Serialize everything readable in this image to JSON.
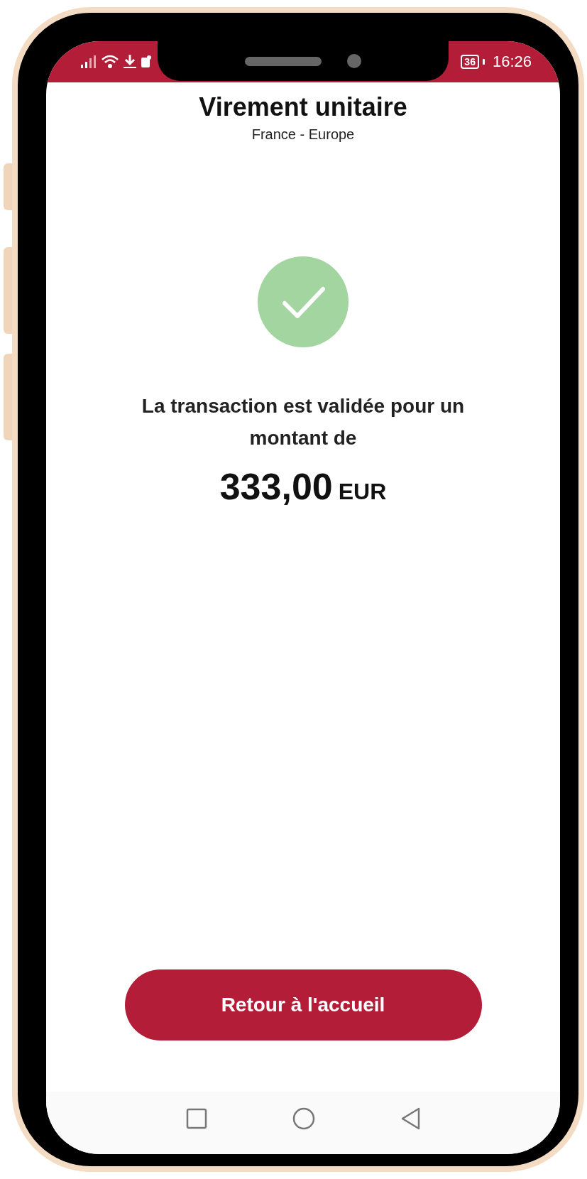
{
  "status_bar": {
    "battery": "36",
    "time": "16:26"
  },
  "header": {
    "title": "Virement unitaire",
    "subtitle": "France - Europe"
  },
  "confirmation": {
    "message": "La transaction est validée pour un montant de",
    "amount": "333,00",
    "currency": "EUR"
  },
  "button": {
    "label": "Retour à l'accueil"
  }
}
